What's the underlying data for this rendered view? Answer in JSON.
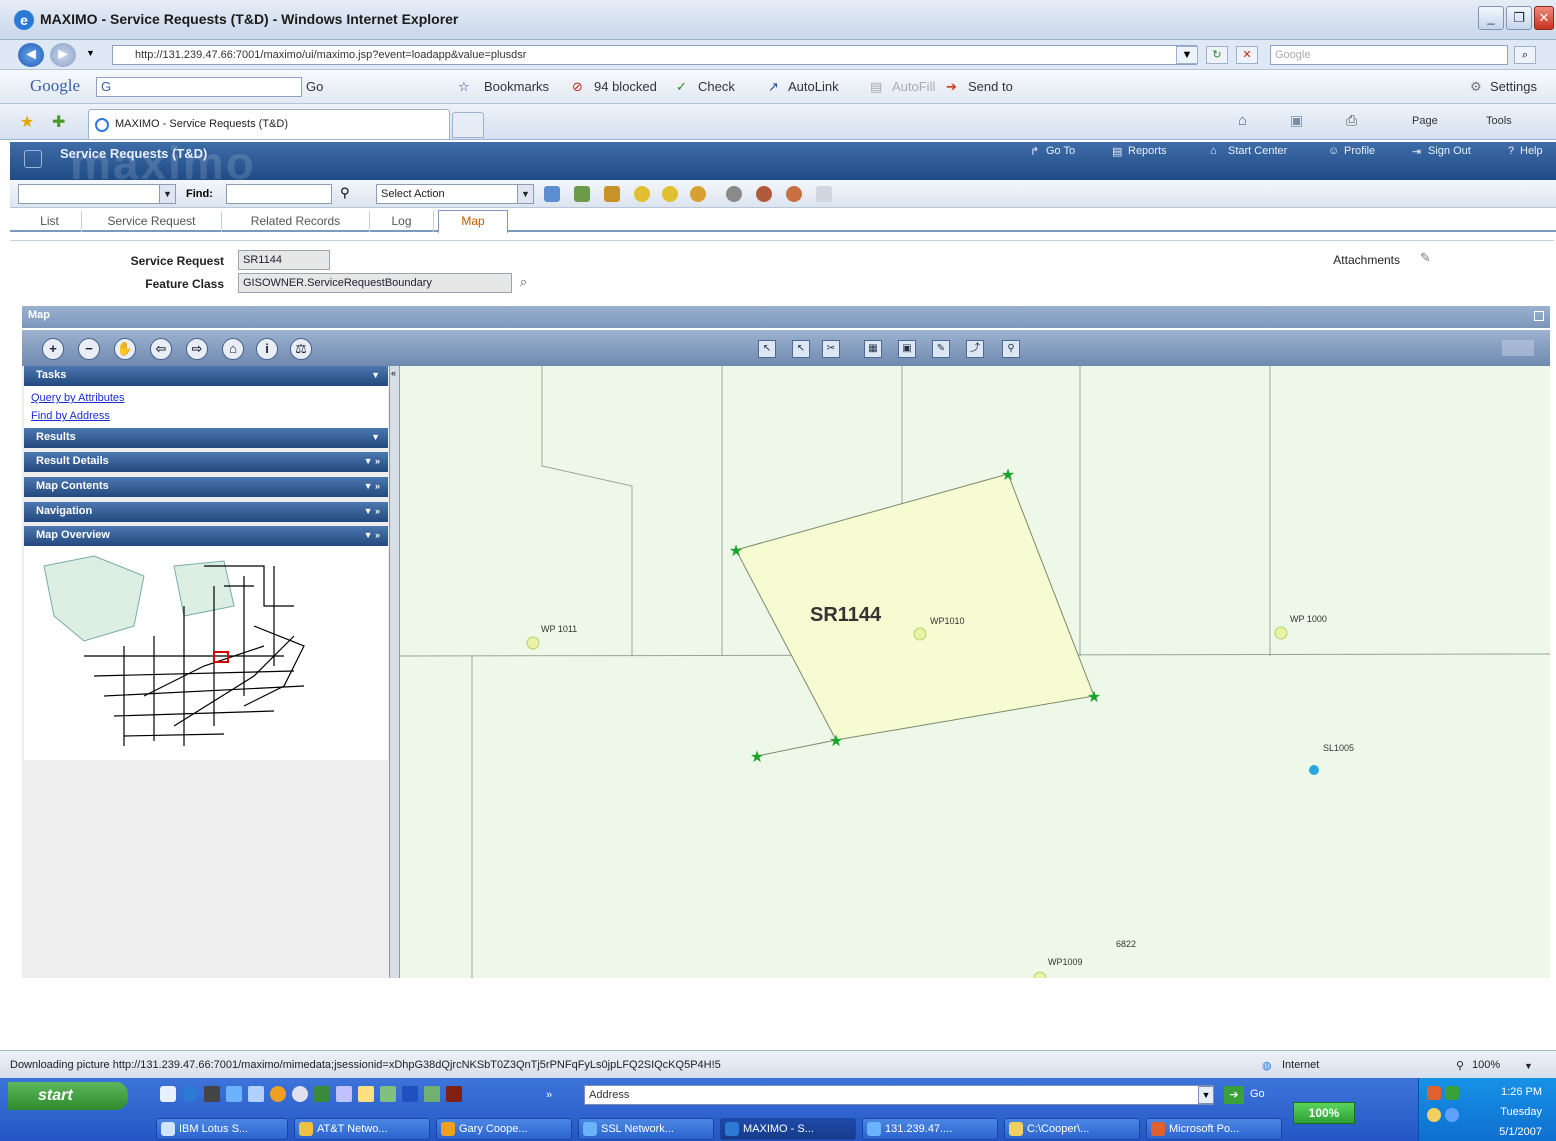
{
  "window": {
    "title": "MAXIMO - Service Requests (T&D) - Windows Internet Explorer",
    "url": "http://131.239.47.66:7001/maximo/ui/maximo.jsp?event=loadapp&value=plusdsr",
    "search_placeholder": "Google"
  },
  "google_toolbar": {
    "logo": "Google",
    "g_label": "G",
    "go": "Go",
    "bookmarks": "Bookmarks",
    "blocked": "94 blocked",
    "check": "Check",
    "autolink": "AutoLink",
    "autofill": "AutoFill",
    "sendto": "Send to",
    "settings": "Settings"
  },
  "ie_tab": {
    "label": "MAXIMO - Service Requests (T&D)",
    "page": "Page",
    "tools": "Tools"
  },
  "maximo": {
    "app_title": "Service Requests (T&D)",
    "watermark": "maximo",
    "header_links": [
      "Go To",
      "Reports",
      "Start Center",
      "Profile",
      "Sign Out",
      "Help"
    ],
    "find_label": "Find:",
    "select_action": "Select Action",
    "tabs": [
      "List",
      "Service Request",
      "Related Records",
      "Log",
      "Map"
    ],
    "active_tab": "Map",
    "fields": {
      "service_request_label": "Service Request",
      "service_request_value": "SR1144",
      "feature_class_label": "Feature Class",
      "feature_class_value": "GISOWNER.ServiceRequestBoundary",
      "attachments_label": "Attachments"
    },
    "map_section": "Map",
    "panel": {
      "tasks": "Tasks",
      "links": [
        "Query by Attributes",
        "Find by Address"
      ],
      "headers": [
        "Results",
        "Result Details",
        "Map Contents",
        "Navigation",
        "Map Overview"
      ]
    },
    "map_labels": {
      "polygon": "SR1144",
      "wp1011": "WP 1011",
      "wp1010": "WP1010",
      "wp1000": "WP 1000",
      "sl1005": "SL1005",
      "wp1009": "WP1009",
      "num_6822": "6822"
    }
  },
  "statusbar": {
    "text": "Downloading picture http://131.239.47.66:7001/maximo/mimedata;jsessionid=xDhpG38dQjrcNKSbT0Z3QnTj5rPNFqFyLs0jpLFQ2SIQcKQ5P4H!5",
    "zone": "Internet",
    "zoom": "100%"
  },
  "taskbar": {
    "start": "start",
    "address_label": "Address",
    "go": "Go",
    "zoom": "100%",
    "items": [
      "IBM Lotus S...",
      "AT&T Netwo...",
      "Gary Coope...",
      "SSL Network...",
      "MAXIMO - S...",
      "131.239.47....",
      "C:\\Cooper\\...",
      "Microsoft Po..."
    ],
    "active_index": 4,
    "time": "1:26 PM",
    "day": "Tuesday",
    "date": "5/1/2007"
  },
  "colors": {
    "header_blue": "#1f4b86",
    "map_bg": "#eef8e9",
    "polygon_fill": "#f6fbd2",
    "vertex_green": "#18a42a",
    "active_tab": "#c45a00"
  }
}
